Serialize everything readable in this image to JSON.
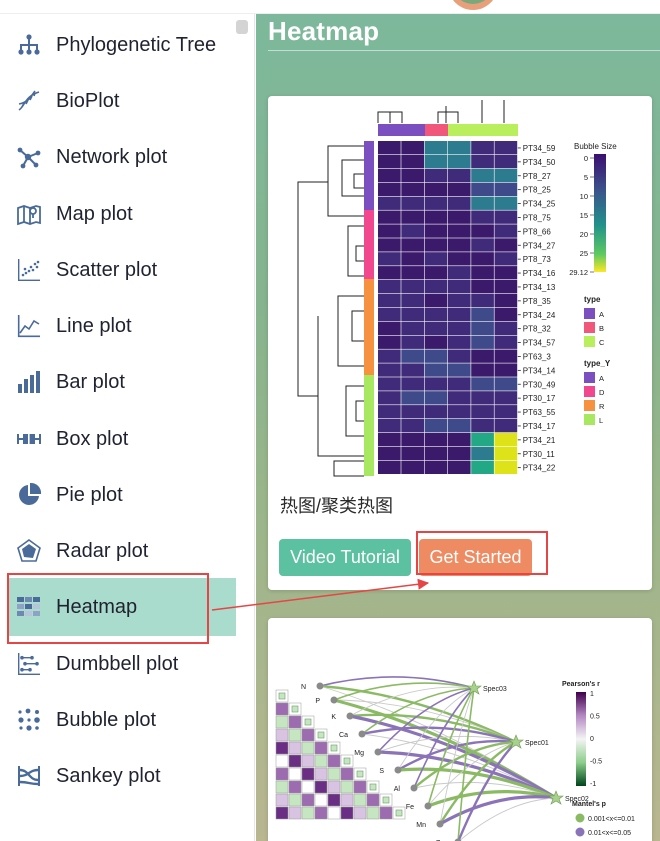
{
  "page": {
    "title": "Heatmap"
  },
  "sidebar": {
    "items": [
      {
        "label": "Phylogenetic Tree",
        "icon": "tree-icon"
      },
      {
        "label": "BioPlot",
        "icon": "dna-icon"
      },
      {
        "label": "Network plot",
        "icon": "network-icon"
      },
      {
        "label": "Map plot",
        "icon": "map-icon"
      },
      {
        "label": "Scatter plot",
        "icon": "scatter-icon"
      },
      {
        "label": "Line plot",
        "icon": "line-chart-icon"
      },
      {
        "label": "Bar plot",
        "icon": "bar-chart-icon"
      },
      {
        "label": "Box plot",
        "icon": "box-plot-icon"
      },
      {
        "label": "Pie plot",
        "icon": "pie-chart-icon"
      },
      {
        "label": "Radar plot",
        "icon": "radar-icon"
      },
      {
        "label": "Heatmap",
        "icon": "heatmap-icon",
        "active": true
      },
      {
        "label": "Dumbbell plot",
        "icon": "dumbbell-icon"
      },
      {
        "label": "Bubble plot",
        "icon": "bubble-icon"
      },
      {
        "label": "Sankey plot",
        "icon": "sankey-icon"
      }
    ]
  },
  "cards": [
    {
      "caption": "热图/聚类热图",
      "video_label": "Video Tutorial",
      "start_label": "Get Started",
      "preview": {
        "rows": [
          "PT34_59",
          "PT34_50",
          "PT8_27",
          "PT8_25",
          "PT34_25",
          "PT8_75",
          "PT8_66",
          "PT34_27",
          "PT8_73",
          "PT34_16",
          "PT34_13",
          "PT8_35",
          "PT34_24",
          "PT8_32",
          "PT34_57",
          "PT63_3",
          "PT34_14",
          "PT30_49",
          "PT30_17",
          "PT63_55",
          "PT34_17",
          "PT34_21",
          "PT30_11",
          "PT34_22"
        ],
        "legend_title": "Bubble Size",
        "legend_ticks": [
          "0",
          "5",
          "10",
          "15",
          "20",
          "25",
          "29.12"
        ],
        "type_title": "type",
        "type_items": [
          "A",
          "B",
          "C"
        ],
        "typey_title": "type_Y",
        "typey_items": [
          "A",
          "D",
          "R",
          "L"
        ]
      }
    },
    {
      "preview": {
        "row_labels": [
          "N",
          "P",
          "K",
          "Ca",
          "Mg",
          "S",
          "Al",
          "Fe",
          "Mn",
          "Zn"
        ],
        "spec_labels": [
          "Spec03",
          "Spec01",
          "Spec02"
        ],
        "legend_r_title": "Pearson's r",
        "legend_r_ticks": [
          "1",
          "0.5",
          "0",
          "-0.5",
          "-1"
        ],
        "legend_p_title": "Mantel's p",
        "legend_p_items": [
          "0.001<x<=0.01",
          "0.01<x<=0.05"
        ]
      }
    }
  ],
  "colors": {
    "accent": "#5cc1a0",
    "active_bg": "#a9dccc",
    "start_button": "#ee8b62",
    "highlight_box": "#e64545",
    "icon": "#4a6b9a"
  }
}
